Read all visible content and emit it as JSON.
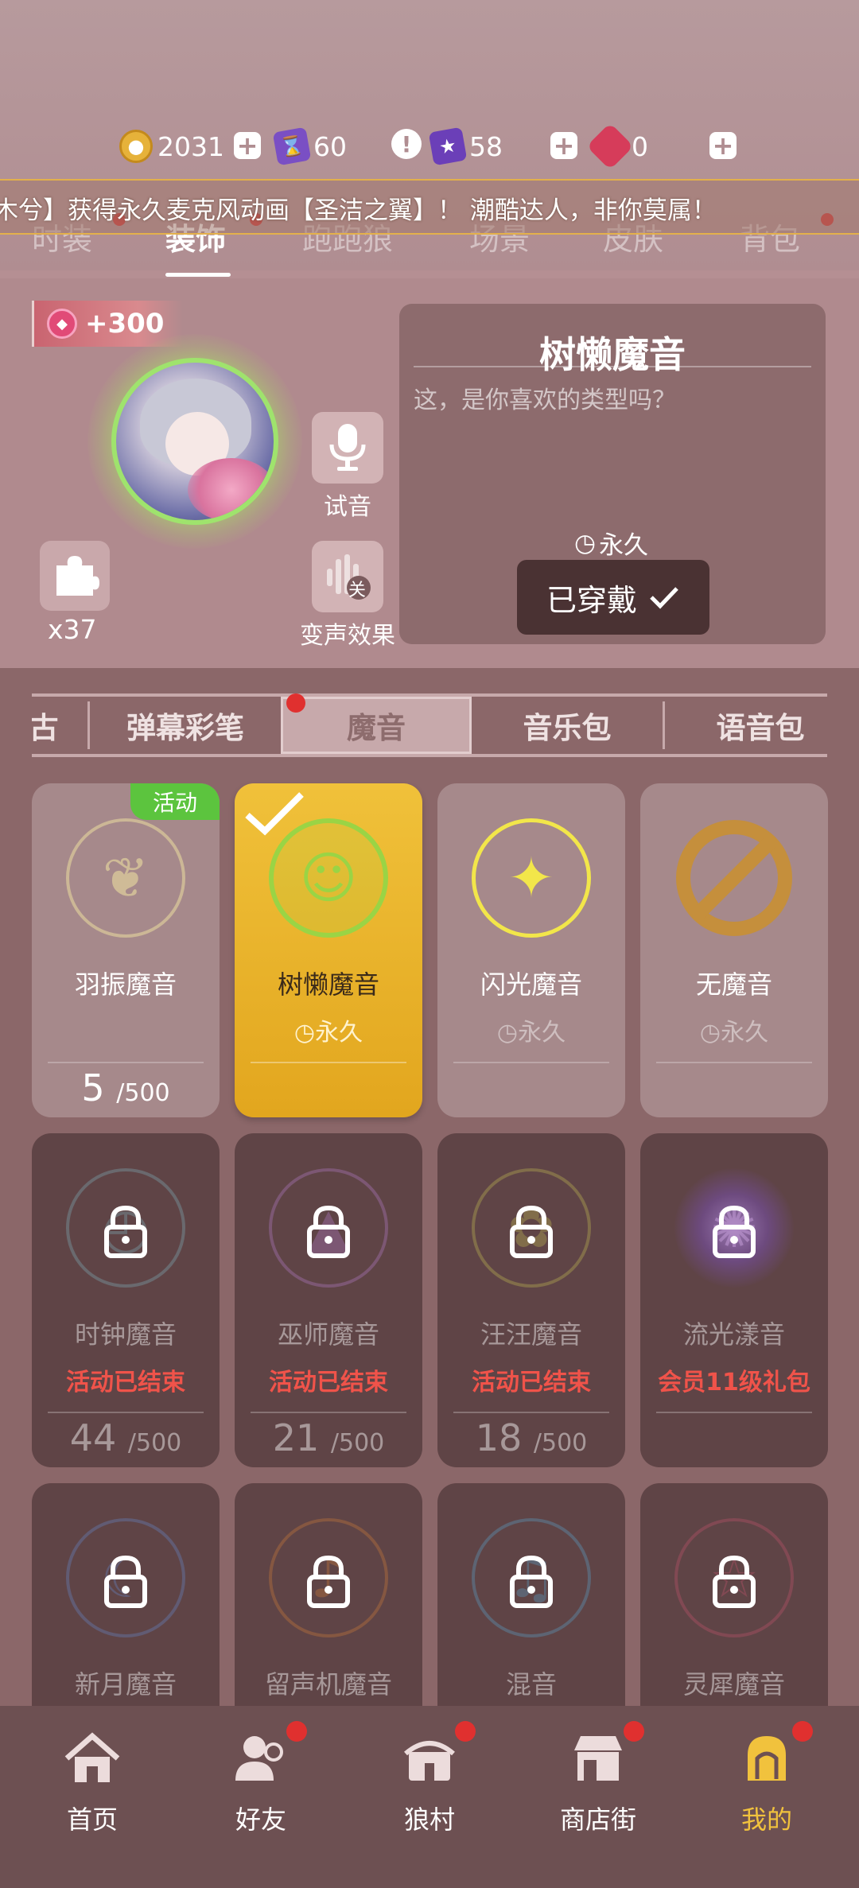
{
  "currency": {
    "gold": "2031",
    "ticket": "60",
    "star_card": "58",
    "gem": "0"
  },
  "marquee_text": "木兮】获得永久麦克风动画【圣洁之翼】！ 潮酷达人，非你莫属！",
  "category_tabs": [
    "时装",
    "装饰",
    "跑跑狼",
    "场景",
    "皮肤",
    "背包"
  ],
  "profile": {
    "bonus": "+300",
    "audition_label": "试音",
    "voice_effect_label": "变声效果",
    "voice_effect_badge": "关",
    "puzzle_count": "x37"
  },
  "info": {
    "title": "树懒魔音",
    "description": "这，是你喜欢的类型吗？",
    "duration": "永久",
    "worn_label": "已穿戴"
  },
  "sub_tabs": [
    "古",
    "弹幕彩笔",
    "魔音",
    "音乐包",
    "语音包"
  ],
  "items": [
    {
      "name": "羽振魔音",
      "tag": "活动",
      "count": "5",
      "max": "/500"
    },
    {
      "name": "树懒魔音",
      "duration": "永久"
    },
    {
      "name": "闪光魔音",
      "duration": "永久"
    },
    {
      "name": "无魔音",
      "duration": "永久"
    },
    {
      "name": "时钟魔音",
      "status": "活动已结束",
      "count": "44",
      "max": "/500"
    },
    {
      "name": "巫师魔音",
      "status": "活动已结束",
      "count": "21",
      "max": "/500"
    },
    {
      "name": "汪汪魔音",
      "status": "活动已结束",
      "count": "18",
      "max": "/500"
    },
    {
      "name": "流光漾音",
      "status": "会员11级礼包"
    },
    {
      "name": "新月魔音"
    },
    {
      "name": "留声机魔音"
    },
    {
      "name": "混音"
    },
    {
      "name": "灵犀魔音"
    }
  ],
  "nav": [
    {
      "label": "首页",
      "icon": "home-icon"
    },
    {
      "label": "好友",
      "icon": "friends-icon"
    },
    {
      "label": "狼村",
      "icon": "village-icon"
    },
    {
      "label": "商店街",
      "icon": "shop-icon"
    },
    {
      "label": "我的",
      "icon": "profile-icon"
    }
  ],
  "colors": {
    "selected_card": "#f0c13a",
    "ended_text": "#f0534a",
    "active_nav": "#f1c23d",
    "red_dot": "#e0302f",
    "event_tag": "#5cc43e"
  }
}
